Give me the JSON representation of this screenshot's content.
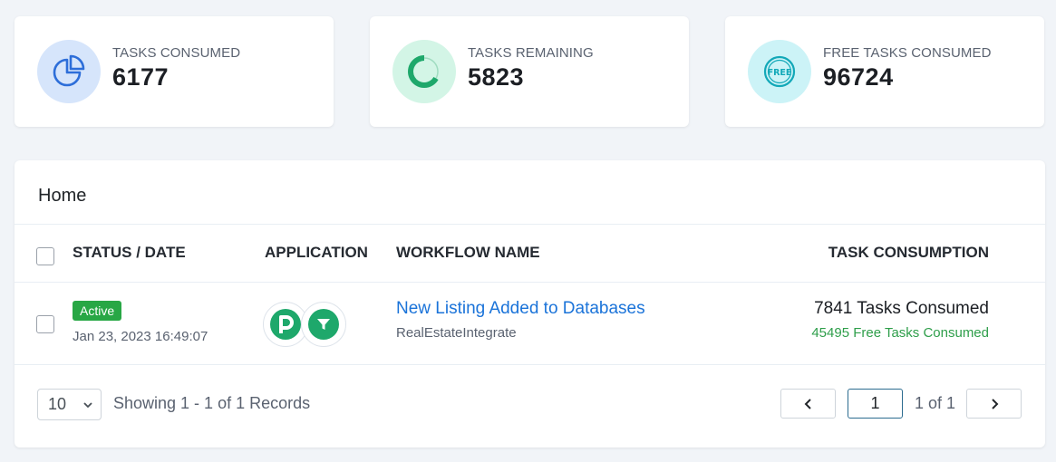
{
  "stats": [
    {
      "label": "TASKS CONSUMED",
      "value": "6177",
      "icon": "pie-chart-icon",
      "color": "#2d6ed9",
      "bg": "#d6e5fb"
    },
    {
      "label": "TASKS REMAINING",
      "value": "5823",
      "icon": "donut-progress-icon",
      "color": "#1ea86b",
      "bg": "#d3f5e6"
    },
    {
      "label": "FREE TASKS CONSUMED",
      "value": "96724",
      "icon": "free-badge-icon",
      "color": "#12a8b8",
      "bg": "#ccf3f7"
    }
  ],
  "main": {
    "title": "Home",
    "columns": {
      "status_date": "STATUS / DATE",
      "application": "APPLICATION",
      "workflow_name": "WORKFLOW NAME",
      "task_consumption": "TASK CONSUMPTION"
    },
    "rows": [
      {
        "status": "Active",
        "date": "Jan 23, 2023 16:49:07",
        "apps": [
          "p-app-icon",
          "filter-app-icon"
        ],
        "workflow_name": "New Listing Added to Databases",
        "workflow_app": "RealEstateIntegrate",
        "tasks_consumed": "7841 Tasks Consumed",
        "free_tasks_consumed": "45495 Free Tasks Consumed"
      }
    ]
  },
  "pagination": {
    "page_size": "10",
    "showing": "Showing 1 - 1 of 1 Records",
    "current_page": "1",
    "page_of": "1 of 1"
  },
  "colors": {
    "accent": "#1a73d9",
    "active": "#28a745",
    "free_text": "#2e9e4a"
  }
}
